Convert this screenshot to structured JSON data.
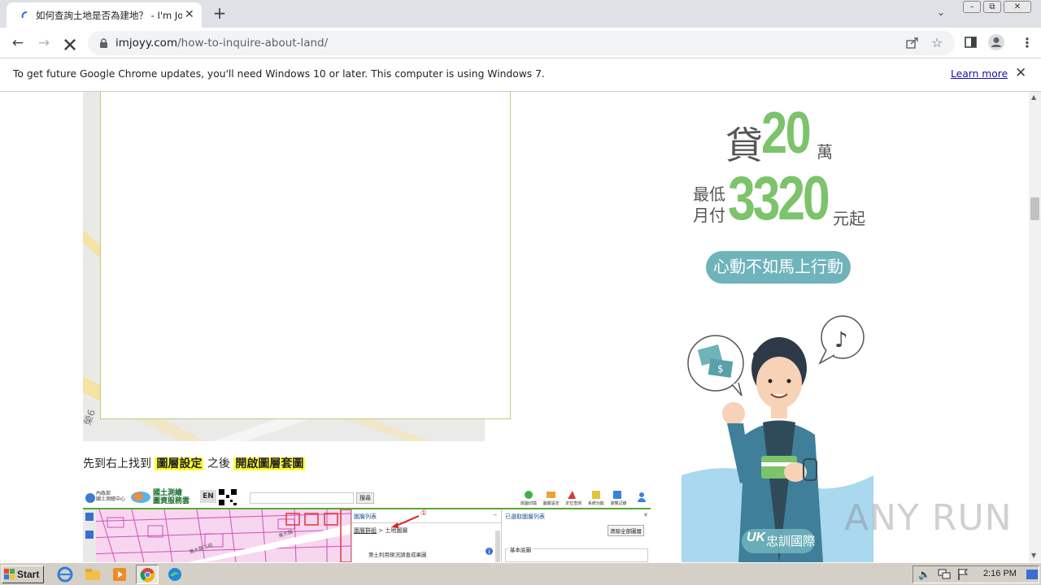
{
  "tab": {
    "title": "如何查詢土地是否為建地？ - I'm Joy",
    "close": "✕"
  },
  "window": {
    "minimize": "▭",
    "restore": "⧉",
    "close": "✕"
  },
  "url": {
    "domain": "imjoyy.com",
    "path": "/how-to-inquire-about-land/"
  },
  "infobar": {
    "message": "To get future Google Chrome updates, you'll need Windows 10 or later. This computer is using Windows 7.",
    "link": "Learn more",
    "close": "✕"
  },
  "article": {
    "caption_prefix": "先到右上找到",
    "caption_hl1": "圖層設定",
    "caption_mid": "之後",
    "caption_hl2": "開啟圖層套圖",
    "map_label": "榮6",
    "shot": {
      "site_title_1": "內政部",
      "site_title_2": "國土測繪中心",
      "brand_1": "國土測繪",
      "brand_2": "圖資服務雲",
      "lang": "EN",
      "search_btn": "搜尋",
      "tools": [
        "底圖切換",
        "圖層設定",
        "定位查詢",
        "系統功能",
        "瀏覽記錄"
      ],
      "panel_title": "圖層列表",
      "panel_crumb_link": "圖層群組",
      "panel_crumb_rest": " > 土地圖層",
      "panel_item": "第土利用現況調查成果圖",
      "marker": "①",
      "right_title": "已選取圖層列表",
      "right_btn": "清除全部圖層",
      "right_section": "基本底圖",
      "map_road": "東大路",
      "map_road2": "東大路二段"
    }
  },
  "ad": {
    "loan_prefix": "貸",
    "loan_amount": "20",
    "loan_unit": "萬",
    "min_1": "最低",
    "min_2": "月付",
    "monthly": "3320",
    "monthly_suffix": "元起",
    "cta": "心動不如馬上行動",
    "brand_mark": "UK",
    "brand_name": "忠訓國際"
  },
  "watermark": "ANY RUN",
  "taskbar": {
    "start": "Start",
    "clock": "2:16 PM"
  },
  "colors": {
    "ad_green": "#7cc36b",
    "ad_teal": "#6fb3bb",
    "highlight": "#ffff33",
    "link": "#1a0dab"
  }
}
